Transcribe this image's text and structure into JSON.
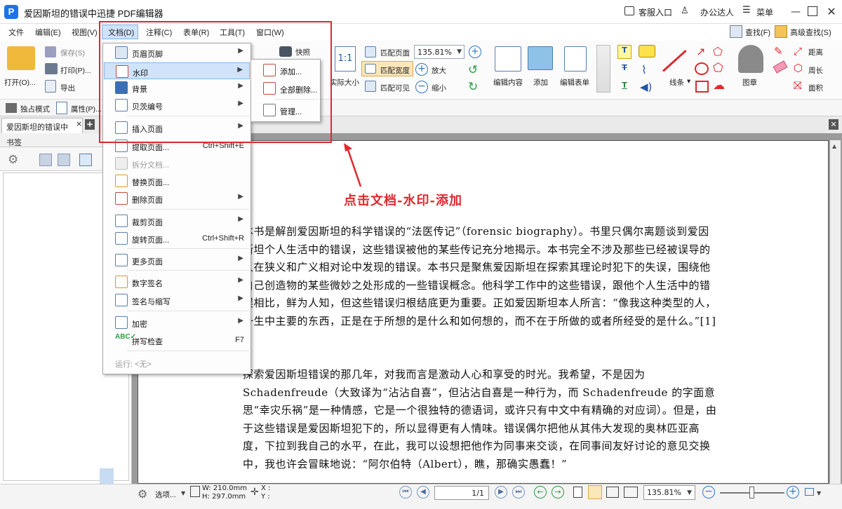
{
  "titlebar": {
    "title": "爱因斯坦的错误中迅捷 PDF编辑器",
    "support": "客服入口",
    "user": "办公达人",
    "menu": "菜单",
    "logo": "P"
  },
  "menubar": {
    "items": [
      "文件",
      "编辑(E)",
      "视图(V)",
      "文档(D)",
      "注释(C)",
      "表单(R)",
      "工具(T)",
      "窗口(W)"
    ],
    "search": "查找(F)",
    "adv_search": "高级查找(S)"
  },
  "ribbon": {
    "open": "打开(O)...",
    "save": "保存(S)",
    "print": "打印(P)...",
    "export": "导出",
    "snapshot": "快照",
    "actual_size": "实际大小",
    "fit_page": "匹配页面",
    "fit_width": "匹配宽度",
    "fit_visible": "匹配可见",
    "zoom": "135.81%",
    "zoom_in": "放大",
    "zoom_out": "缩小",
    "edit_content": "编辑内容",
    "add": "添加",
    "edit_form": "编辑表单",
    "line": "线条",
    "stamp": "图章",
    "distance": "距离",
    "perimeter": "周长",
    "area": "面积",
    "line_chevron": "▾"
  },
  "subbar": {
    "exclusive": "独占模式",
    "properties": "属性(P)..."
  },
  "tabs": {
    "doc": "爱因斯坦的错误中",
    "close": "×",
    "add": "+"
  },
  "sidebar": {
    "title": "书签"
  },
  "doc_menu": {
    "items": [
      {
        "label": "页眉页脚",
        "arrow": "▶"
      },
      {
        "label": "水印",
        "arrow": "▶"
      },
      {
        "label": "背景",
        "arrow": "▶"
      },
      {
        "label": "贝茨编号",
        "arrow": "▶"
      },
      {
        "label": "插入页面",
        "arrow": "▶"
      },
      {
        "label": "提取页面...",
        "shortcut": "Ctrl+Shift+E"
      },
      {
        "label": "拆分文档..."
      },
      {
        "label": "替换页面..."
      },
      {
        "label": "删除页面",
        "arrow": "▶"
      },
      {
        "label": "裁剪页面",
        "arrow": "▶"
      },
      {
        "label": "旋转页面...",
        "shortcut": "Ctrl+Shift+R"
      },
      {
        "label": "更多页面",
        "arrow": "▶"
      },
      {
        "label": "数字签名",
        "arrow": "▶"
      },
      {
        "label": "签名与缩写",
        "arrow": "▶"
      },
      {
        "label": "加密",
        "arrow": "▶"
      },
      {
        "label": "拼写检查",
        "shortcut": "F7"
      },
      {
        "label": "运行: <无>"
      }
    ]
  },
  "watermark_submenu": {
    "items": [
      {
        "label": "添加..."
      },
      {
        "label": "全部删除..."
      },
      {
        "label": "管理..."
      }
    ]
  },
  "annotation": {
    "text": "点击文档-水印-添加"
  },
  "document": {
    "paragraphs": [
      "本书是解剖爱因斯坦的科学错误的“法医传记”（forensic biography）。书里只偶尔离题谈到爱因斯坦个人生活中的错误，这些错误被他的某些传记充分地揭示。本书完全不涉及那些已经被误导的人在狭义和广义相对论中发现的错误。本书只是聚焦爱因斯坦在探索其理论时犯下的失误，围绕他自己创造物的某些微妙之处形成的一些错误概念。他科学工作中的这些错误，跟他个人生活中的错误相比，鲜为人知，但这些错误归根结底更为重要。正如爱因斯坦本人所言：“像我这种类型的人，一生中主要的东西，正是在于所想的是什么和如何想的，而不在于所做的或者所经受的是什么。”[1]",
      "探索爱因斯坦错误的那几年，对我而言是激动人心和享受的时光。我希望，不是因为Schadenfreude（大致译为“沾沾自喜”，但沾沾自喜是一种行为，而 Schadenfreude 的字面意思“幸灾乐祸”是一种情感，它是一个很独特的德语词，或许只有中文中有精确的对应词）。但是，由于这些错误是爱因斯坦犯下的，所以显得更有人情味。错误偶尔把他从其伟大发现的奥林匹亚高度，下拉到我自己的水平，在此，我可以设想把他作为同事来交谈，在同事间友好讨论的意见交换中，我也许会冒昧地说：“阿尔伯特（Albert），瞧，那确实愚蠢！”"
    ]
  },
  "statusbar": {
    "options": "选项...",
    "width": "W: 210.0mm",
    "height": "H: 297.0mm",
    "x": "X :",
    "y": "Y :",
    "page": "1/1",
    "zoom": "135.81%"
  }
}
